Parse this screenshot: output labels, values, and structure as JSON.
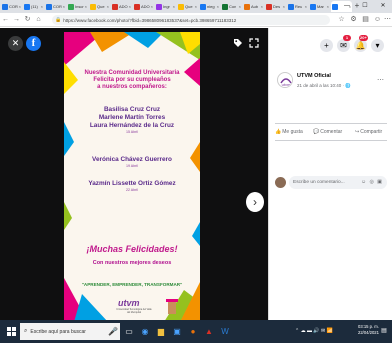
{
  "browser": {
    "tabs": [
      {
        "label": "COR",
        "color": "#1a73e8"
      },
      {
        "label": "(11)",
        "color": "#1877f2"
      },
      {
        "label": "COR",
        "color": "#1a73e8"
      },
      {
        "label": "Inscr",
        "color": "#34a853"
      },
      {
        "label": "Que",
        "color": "#fbbc04"
      },
      {
        "label": "ADO",
        "color": "#d93025"
      },
      {
        "label": "ADO",
        "color": "#d93025"
      },
      {
        "label": "Ingr",
        "color": "#9334e6"
      },
      {
        "label": "Que",
        "color": "#fbbc04"
      },
      {
        "label": "nieg",
        "color": "#1877f2"
      },
      {
        "label": "Con",
        "color": "#137333"
      },
      {
        "label": "Aub",
        "color": "#e8710a"
      },
      {
        "label": "Des",
        "color": "#d93025"
      },
      {
        "label": "Reu",
        "color": "#1a73e8"
      },
      {
        "label": "Mar",
        "color": "#1877f2"
      },
      {
        "label": "",
        "color": "#1877f2",
        "active": true
      }
    ],
    "url": "https://www.facebook.com/photo/?fbid=398658096183537&set=pcb.398659711183312",
    "nav": {
      "back": "←",
      "forward": "→",
      "reload": "↻",
      "home": "⌂"
    }
  },
  "viewer": {
    "close": "✕",
    "logo": "f",
    "next": "›"
  },
  "flyer": {
    "heading": [
      "Nuestra Comunidad Universitaria",
      "Felicita por su cumpleaños",
      "a nuestros compañeros:"
    ],
    "people": [
      {
        "names": [
          "Basilisa Cruz Cruz",
          "Marlene Martín Torres",
          "Laura Hernández de la Cruz"
        ],
        "date": "15 Abril"
      },
      {
        "names": [
          "Verónica Chávez Guerrero"
        ],
        "date": "19 Abril"
      },
      {
        "names": [
          "Yazmín Lissette Ortiz Gómez"
        ],
        "date": "22 Abril"
      }
    ],
    "congrats": "¡Muchas Felicidades!",
    "wishes": "Con nuestros mejores deseos",
    "motto": "\"APRENDER, EMPRENDER, TRANSFORMAR\"",
    "logo": "utvm",
    "logo_sub": "Universidad Tecnológica del Valle del Mezquital"
  },
  "panel": {
    "badges": {
      "messenger": "1",
      "notifications": "20+"
    },
    "post": {
      "author": "UTVM Oficial",
      "meta": "21 de abril a las 10:40 · 🌐"
    },
    "actions": {
      "like": "Me gusta",
      "comment": "Comentar",
      "share": "Compartir"
    },
    "comment_placeholder": "Escribe un comentario..."
  },
  "taskbar": {
    "search_placeholder": "Escribe aquí para buscar",
    "time": "03:15 p. m.",
    "date": "22/04/2021"
  }
}
